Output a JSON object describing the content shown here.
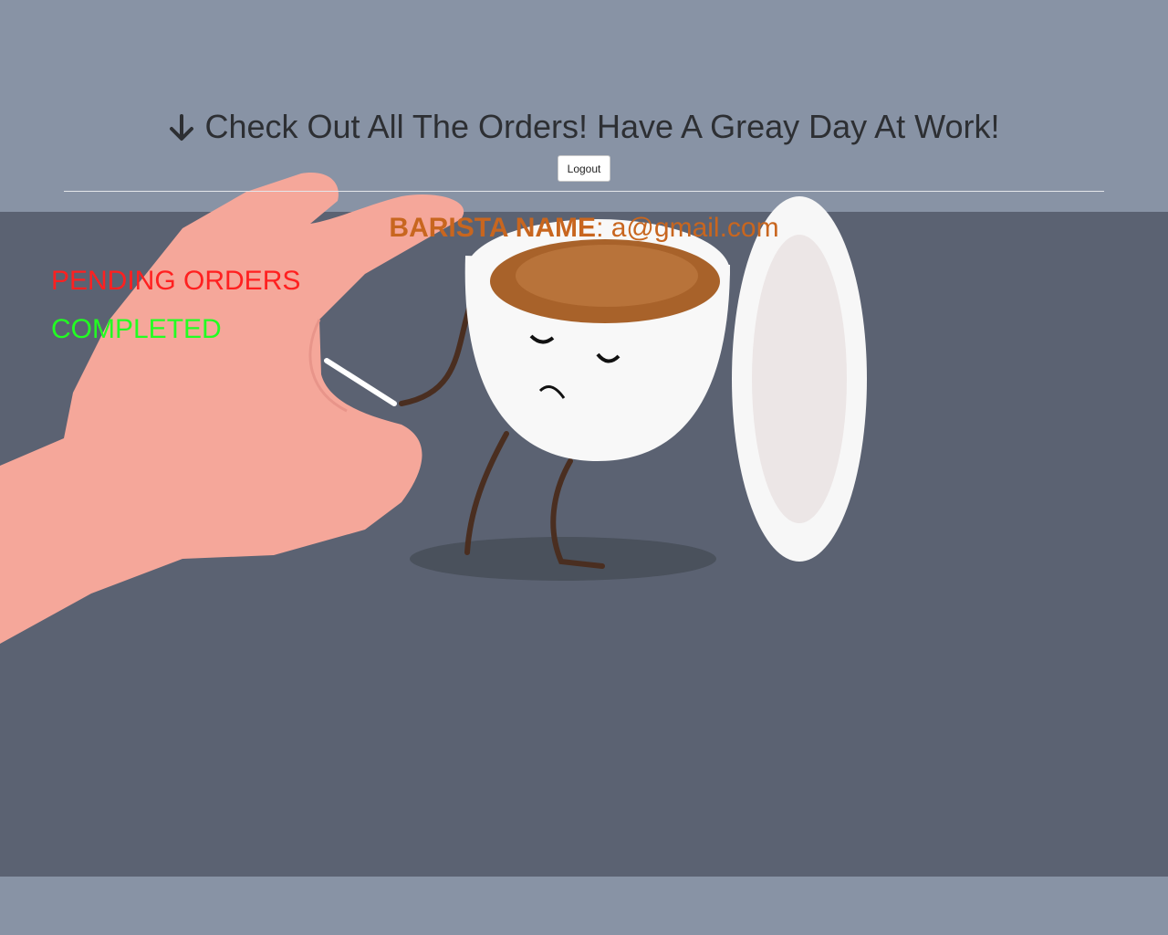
{
  "header": {
    "arrow_icon": "arrow-down-icon",
    "title": "Check Out All The Orders! Have A Greay Day At Work!",
    "logout_label": "Logout"
  },
  "barista": {
    "label": "BARISTA NAME",
    "separator": ":",
    "email": "a@gmail.com"
  },
  "nav": {
    "pending_label": "PENDING ORDERS",
    "pending_color": "#ff2020",
    "completed_label": "COMPLETED",
    "completed_color": "#22ff22"
  },
  "colors": {
    "top_band": "#8893a5",
    "panel": "#5b6272",
    "accent": "#c8661f"
  }
}
